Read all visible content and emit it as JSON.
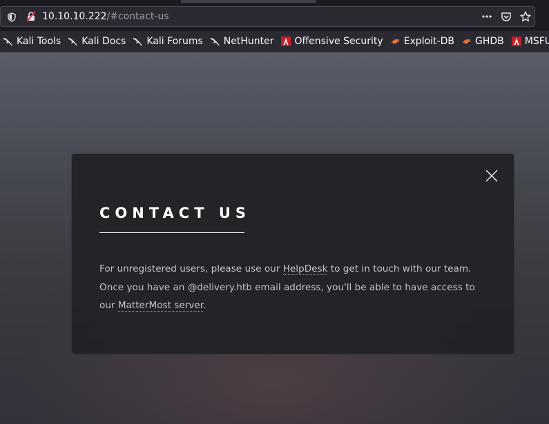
{
  "browser": {
    "url_host": "10.10.10.222",
    "url_path": "/#contact-us",
    "url_actions": [
      "more-icon",
      "pocket-icon",
      "bookmark-star-icon"
    ]
  },
  "bookmarks": [
    {
      "label": "Kali Tools",
      "icon": "kali-dragon-icon"
    },
    {
      "label": "Kali Docs",
      "icon": "kali-dragon-icon"
    },
    {
      "label": "Kali Forums",
      "icon": "kali-dragon-icon"
    },
    {
      "label": "NetHunter",
      "icon": "kali-dragon-icon"
    },
    {
      "label": "Offensive Security",
      "icon": "offsec-icon"
    },
    {
      "label": "Exploit-DB",
      "icon": "exploitdb-icon"
    },
    {
      "label": "GHDB",
      "icon": "exploitdb-icon"
    },
    {
      "label": "MSFU",
      "icon": "offsec-icon"
    }
  ],
  "modal": {
    "title": "CONTACT US",
    "text_1": "For unregistered users, please use our ",
    "link_helpdesk": "HelpDesk",
    "text_2": " to get in touch with our team. Once you have an @delivery.htb email address, you'll be able to have access to our ",
    "link_mattermost": "MatterMost server",
    "text_3": "."
  },
  "colors": {
    "modal_bg": "#212326",
    "text": "#c4c4c6",
    "title": "#ffffff"
  }
}
